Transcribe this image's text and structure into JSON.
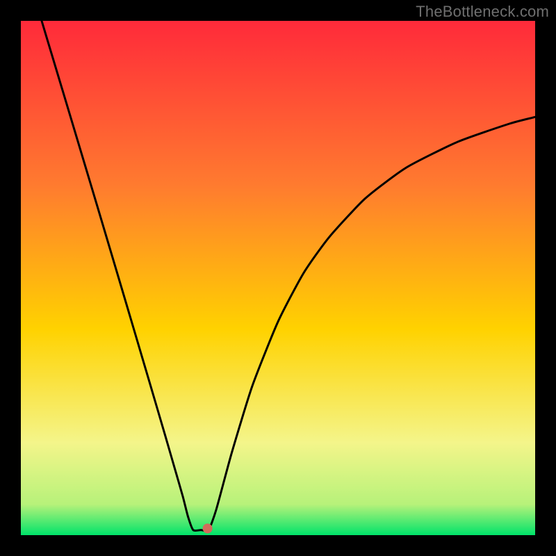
{
  "watermark": "TheBottleneck.com",
  "chart_data": {
    "type": "line",
    "title": "",
    "xlabel": "",
    "ylabel": "",
    "xlim": [
      0,
      100
    ],
    "ylim": [
      0,
      100
    ],
    "grid": false,
    "legend": false,
    "background_gradient": {
      "top": "#ff2a3a",
      "mid1": "#ff7b2f",
      "mid2": "#ffd200",
      "mid3": "#f4f58a",
      "bottom1": "#b7f27a",
      "bottom2": "#00e36a"
    },
    "series": [
      {
        "name": "curve",
        "color": "#000000",
        "x": [
          4.05,
          6,
          10,
          15,
          20,
          25,
          28,
          30,
          31.5,
          32.5,
          33.5,
          35,
          36.5,
          38,
          41,
          45,
          50,
          55,
          60,
          67,
          75,
          85,
          95,
          100
        ],
        "y": [
          100,
          93.5,
          80.2,
          63.5,
          46.7,
          29.8,
          19.6,
          12.7,
          7.5,
          3.6,
          1.0,
          1.0,
          1.0,
          5,
          16,
          29,
          41.5,
          51,
          58,
          65.5,
          71.5,
          76.5,
          80,
          81.3
        ]
      }
    ],
    "flat_bottom": {
      "x_start": 32.5,
      "x_end": 35,
      "y": 1.0
    },
    "marker": {
      "x": 36.3,
      "y": 1.3,
      "color": "#d36a5a",
      "radius_px": 7
    }
  }
}
